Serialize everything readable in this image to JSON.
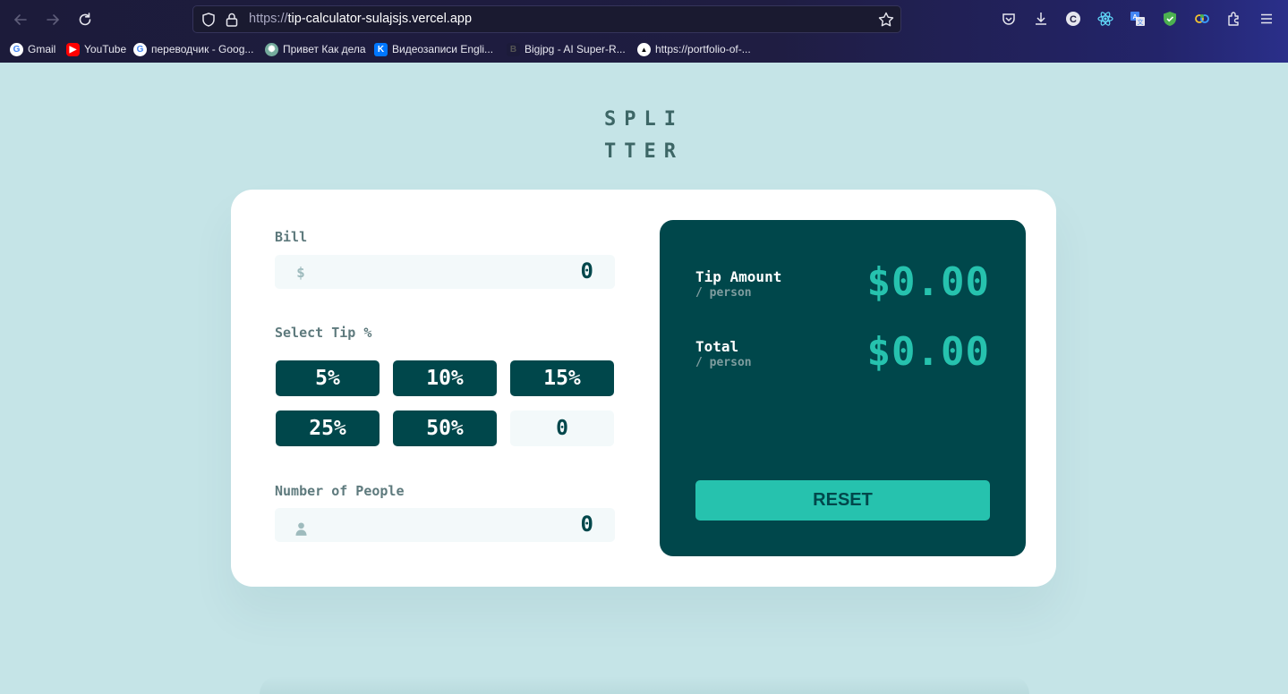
{
  "browser": {
    "url_scheme": "https://",
    "url_host": "tip-calculator-sulajsjs.vercel.app",
    "bookmarks": [
      {
        "label": "Gmail",
        "icon": "google-icon"
      },
      {
        "label": "YouTube",
        "icon": "youtube-icon"
      },
      {
        "label": "переводчик - Goog...",
        "icon": "google-icon"
      },
      {
        "label": "Привет Как дела",
        "icon": "chatgpt-icon"
      },
      {
        "label": "Видеозаписи Engli...",
        "icon": "vk-icon"
      },
      {
        "label": "Bigjpg - AI Super-R...",
        "icon": "bigjpg-icon"
      },
      {
        "label": "https://portfolio-of-...",
        "icon": "vercel-icon"
      }
    ]
  },
  "logo": {
    "line1": "SPLI",
    "line2": "TTER"
  },
  "bill": {
    "label": "Bill",
    "icon": "dollar-icon",
    "value": "0"
  },
  "tip": {
    "label": "Select Tip %",
    "options": [
      "5%",
      "10%",
      "15%",
      "25%",
      "50%"
    ],
    "custom_value": "0"
  },
  "people": {
    "label": "Number of People",
    "icon": "person-icon",
    "value": "0"
  },
  "result": {
    "tip_label": "Tip Amount",
    "tip_sub": "/ person",
    "tip_value": "$0.00",
    "total_label": "Total",
    "total_sub": "/ person",
    "total_value": "$0.00",
    "reset_label": "RESET"
  },
  "colors": {
    "background": "#c5e4e7",
    "dark_cyan": "#00474b",
    "accent": "#26c2ae",
    "label_grey": "#5e7a7d"
  }
}
